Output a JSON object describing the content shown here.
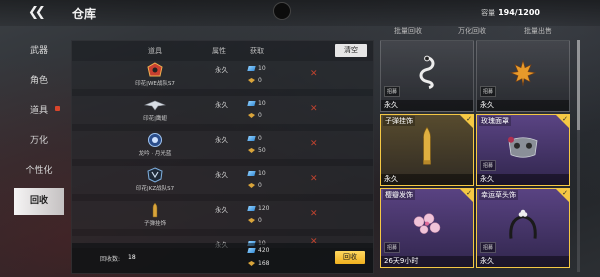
{
  "header": {
    "title": "仓库",
    "capacity_label": "容量",
    "capacity_value": "194/1200"
  },
  "sidebar": {
    "items": [
      {
        "label": "武器",
        "active": false,
        "badge": false
      },
      {
        "label": "角色",
        "active": false,
        "badge": false
      },
      {
        "label": "道具",
        "active": false,
        "badge": true
      },
      {
        "label": "万化",
        "active": false,
        "badge": false
      },
      {
        "label": "个性化",
        "active": false,
        "badge": false
      },
      {
        "label": "回收",
        "active": true,
        "badge": false
      }
    ]
  },
  "table": {
    "headers": {
      "item": "道具",
      "attr": "属性",
      "obtain": "获取"
    },
    "clear_label": "清空",
    "rows": [
      {
        "name": "印花|WE战队S7",
        "attr": "永久",
        "currency_a": "10",
        "currency_b": "0",
        "icon": "wolf-emblem-icon"
      },
      {
        "name": "印花|鹰翅",
        "attr": "永久",
        "currency_a": "10",
        "currency_b": "0",
        "icon": "eagle-wing-icon"
      },
      {
        "name": "龙吟 · 月光蓝",
        "attr": "永久",
        "currency_a": "0",
        "currency_b": "50",
        "icon": "dragon-medal-icon"
      },
      {
        "name": "印花|KZ战队S7",
        "attr": "永久",
        "currency_a": "10",
        "currency_b": "0",
        "icon": "kz-emblem-icon"
      },
      {
        "name": "子弹挂饰",
        "attr": "永久",
        "currency_a": "120",
        "currency_b": "0",
        "icon": "bullet-charm-icon"
      },
      {
        "name": "",
        "attr": "永久",
        "currency_a": "10",
        "currency_b": "0",
        "icon": "item-icon"
      }
    ],
    "footer": {
      "count_label": "回收数:",
      "count": "18",
      "total_a": "420",
      "total_b": "168",
      "recycle_label": "回收"
    }
  },
  "tabs": [
    "批量回收",
    "万化回收",
    "批量出售"
  ],
  "cards": [
    {
      "name": "",
      "tag": "招募",
      "duration": "永久",
      "selected": false,
      "variant": "grey",
      "art": "snake-sigil-icon"
    },
    {
      "name": "",
      "tag": "招募",
      "duration": "永久",
      "selected": false,
      "variant": "grey",
      "art": "maple-leaf-icon"
    },
    {
      "name": "子弹挂饰",
      "tag": "",
      "duration": "永久",
      "selected": true,
      "variant": "gold",
      "art": "bullet-icon"
    },
    {
      "name": "玫瑰面罩",
      "tag": "招募",
      "duration": "永久",
      "selected": true,
      "variant": "purple",
      "art": "rose-mask-icon"
    },
    {
      "name": "樱瓣发饰",
      "tag": "招募",
      "duration": "26天9小时",
      "selected": true,
      "variant": "purple",
      "art": "sakura-hairpin-icon"
    },
    {
      "name": "幸运草头饰",
      "tag": "招募",
      "duration": "永久",
      "selected": true,
      "variant": "purple",
      "art": "clover-headband-icon"
    }
  ],
  "colors": {
    "accent": "#f5c844",
    "delete": "#c0432f",
    "purple_card": "#5f468c"
  }
}
